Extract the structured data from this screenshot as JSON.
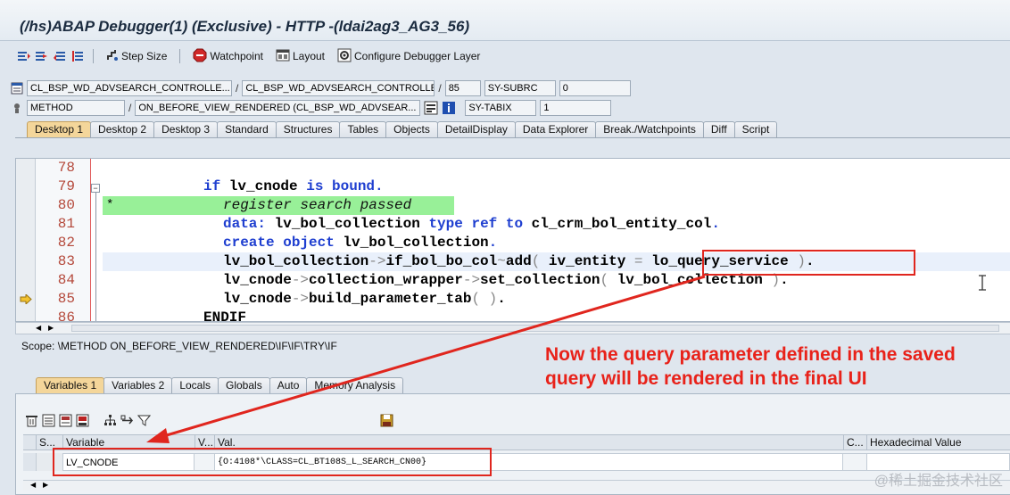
{
  "window": {
    "title": "(/hs)ABAP Debugger(1)  (Exclusive) - HTTP -(ldai2ag3_AG3_56)"
  },
  "toolbar": {
    "step_size": "Step Size",
    "watchpoint": "Watchpoint",
    "layout": "Layout",
    "configure": "Configure Debugger Layer"
  },
  "fields": {
    "row1": {
      "program": "CL_BSP_WD_ADVSEARCH_CONTROLLE...",
      "include": "CL_BSP_WD_ADVSEARCH_CONTROLLE...",
      "line": "85",
      "sysvar": "SY-SUBRC",
      "sysval": "0"
    },
    "row2": {
      "type": "METHOD",
      "event": "ON_BEFORE_VIEW_RENDERED (CL_BSP_WD_ADVSEAR...",
      "sysvar": "SY-TABIX",
      "sysval": "1"
    }
  },
  "tabs": [
    "Desktop 1",
    "Desktop 2",
    "Desktop 3",
    "Standard",
    "Structures",
    "Tables",
    "Objects",
    "DetailDisplay",
    "Data Explorer",
    "Break./Watchpoints",
    "Diff",
    "Script"
  ],
  "code": {
    "lines": [
      "78",
      "79",
      "80",
      "81",
      "82",
      "83",
      "84",
      "85",
      "86"
    ],
    "l79": {
      "kw1": "if",
      "id": " lv_cnode ",
      "kw2": "is bound",
      "end": "."
    },
    "l80": {
      "star": "*",
      "text": "register search passed"
    },
    "l81": {
      "kw1": "data:",
      "id1": " lv_bol_collection ",
      "kw2": "type ref to",
      "id2": " cl_crm_bol_entity_col",
      "end": "."
    },
    "l82": {
      "kw1": "create object",
      "id1": " lv_bol_collection",
      "end": "."
    },
    "l83": {
      "a": "lv_bol_collection",
      "op1": "->",
      "b": "if_bol_bo_col",
      "op2": "~",
      "c": "add",
      "op3": "(",
      "d": " iv_entity ",
      "op4": "=",
      "e": " lo_query_service ",
      "op5": ")",
      "end": "."
    },
    "l84": {
      "a": "lv_cnode",
      "op1": "->",
      "b": "collection_wrapper",
      "op2": "->",
      "c": "set_collection",
      "op3": "(",
      "d": " lv_bol_collection ",
      "op4": ")",
      "end": "."
    },
    "l85": {
      "a": "lv_cnode",
      "op1": "->",
      "b": "build_parameter_tab",
      "op2": "(",
      "op3": " )",
      "end": "."
    },
    "l86": {
      "kw": "ENDIF"
    }
  },
  "scope": "Scope: \\METHOD ON_BEFORE_VIEW_RENDERED\\IF\\IF\\TRY\\IF",
  "annotation": {
    "line1": "Now the query parameter defined in the saved",
    "line2": "query will be rendered in the final UI"
  },
  "var_tabs": [
    "Variables 1",
    "Variables 2",
    "Locals",
    "Globals",
    "Auto",
    "Memory Analysis"
  ],
  "grid": {
    "headers": {
      "s": "S...",
      "variable": "Variable",
      "v": "V...",
      "val": "Val.",
      "c": "C...",
      "hex": "Hexadecimal Value"
    },
    "row": {
      "variable": "LV_CNODE",
      "value": "{O:4108*\\CLASS=CL_BT108S_L_SEARCH_CN00}"
    }
  },
  "watermark": "@稀土掘金技术社区",
  "colors": {
    "accent_red": "#e0261e",
    "active_tab": "#f4d69a",
    "keyword": "#1f3fd0",
    "line_number": "#b4483a",
    "green_highlight": "#98f098"
  }
}
